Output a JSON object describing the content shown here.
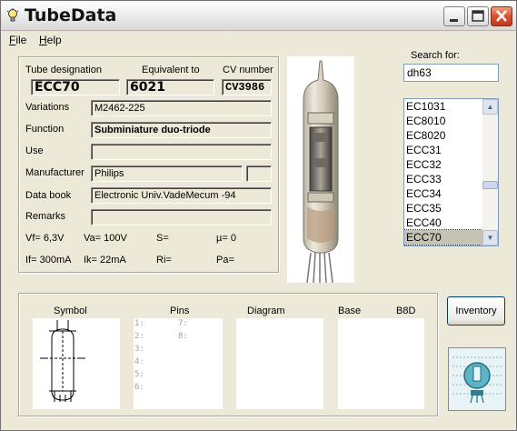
{
  "window": {
    "title": "TubeData"
  },
  "menu": {
    "file": "File",
    "help": "Help"
  },
  "labels": {
    "tube_designation": "Tube designation",
    "equivalent_to": "Equivalent to",
    "cv_number": "CV number",
    "variations": "Variations",
    "function": "Function",
    "use": "Use",
    "manufacturer": "Manufacturer",
    "data_book": "Data book",
    "remarks": "Remarks"
  },
  "values": {
    "tube_designation": "ECC70",
    "equivalent_to": "6021",
    "cv_number": "CV3986",
    "variations": "M2462-225",
    "function": "Subminiature duo-triode",
    "use": "",
    "manufacturer": "Philips",
    "manufacturer_extra": "",
    "data_book": "Electronic Univ.VadeMecum -94",
    "remarks": ""
  },
  "params": {
    "vf": "Vf= 6,3V",
    "va": "Va= 100V",
    "s": "S=",
    "mu": "µ=   0",
    "if": "If= 300mA",
    "ik": "Ik=  22mA",
    "ri": "Ri=",
    "pa": "Pa="
  },
  "search": {
    "label": "Search for:",
    "value": "dh63"
  },
  "tube_list": {
    "items": [
      "EC1031",
      "EC8010",
      "EC8020",
      "ECC31",
      "ECC32",
      "ECC33",
      "ECC34",
      "ECC35",
      "ECC40",
      "ECC70"
    ],
    "selected": "ECC70",
    "scroll_up": "▲",
    "scroll_down": "▼"
  },
  "bottom": {
    "symbol": "Symbol",
    "pins": "Pins",
    "diagram": "Diagram",
    "base": "Base",
    "base_value": "B8D",
    "pin_labels": [
      "1:",
      "2:",
      "3:",
      "4:",
      "5:",
      "6:",
      "7:",
      "8:"
    ]
  },
  "buttons": {
    "inventory": "Inventory"
  },
  "colors": {
    "selection": "#c6c3b5",
    "close_button": "#d9532f"
  }
}
